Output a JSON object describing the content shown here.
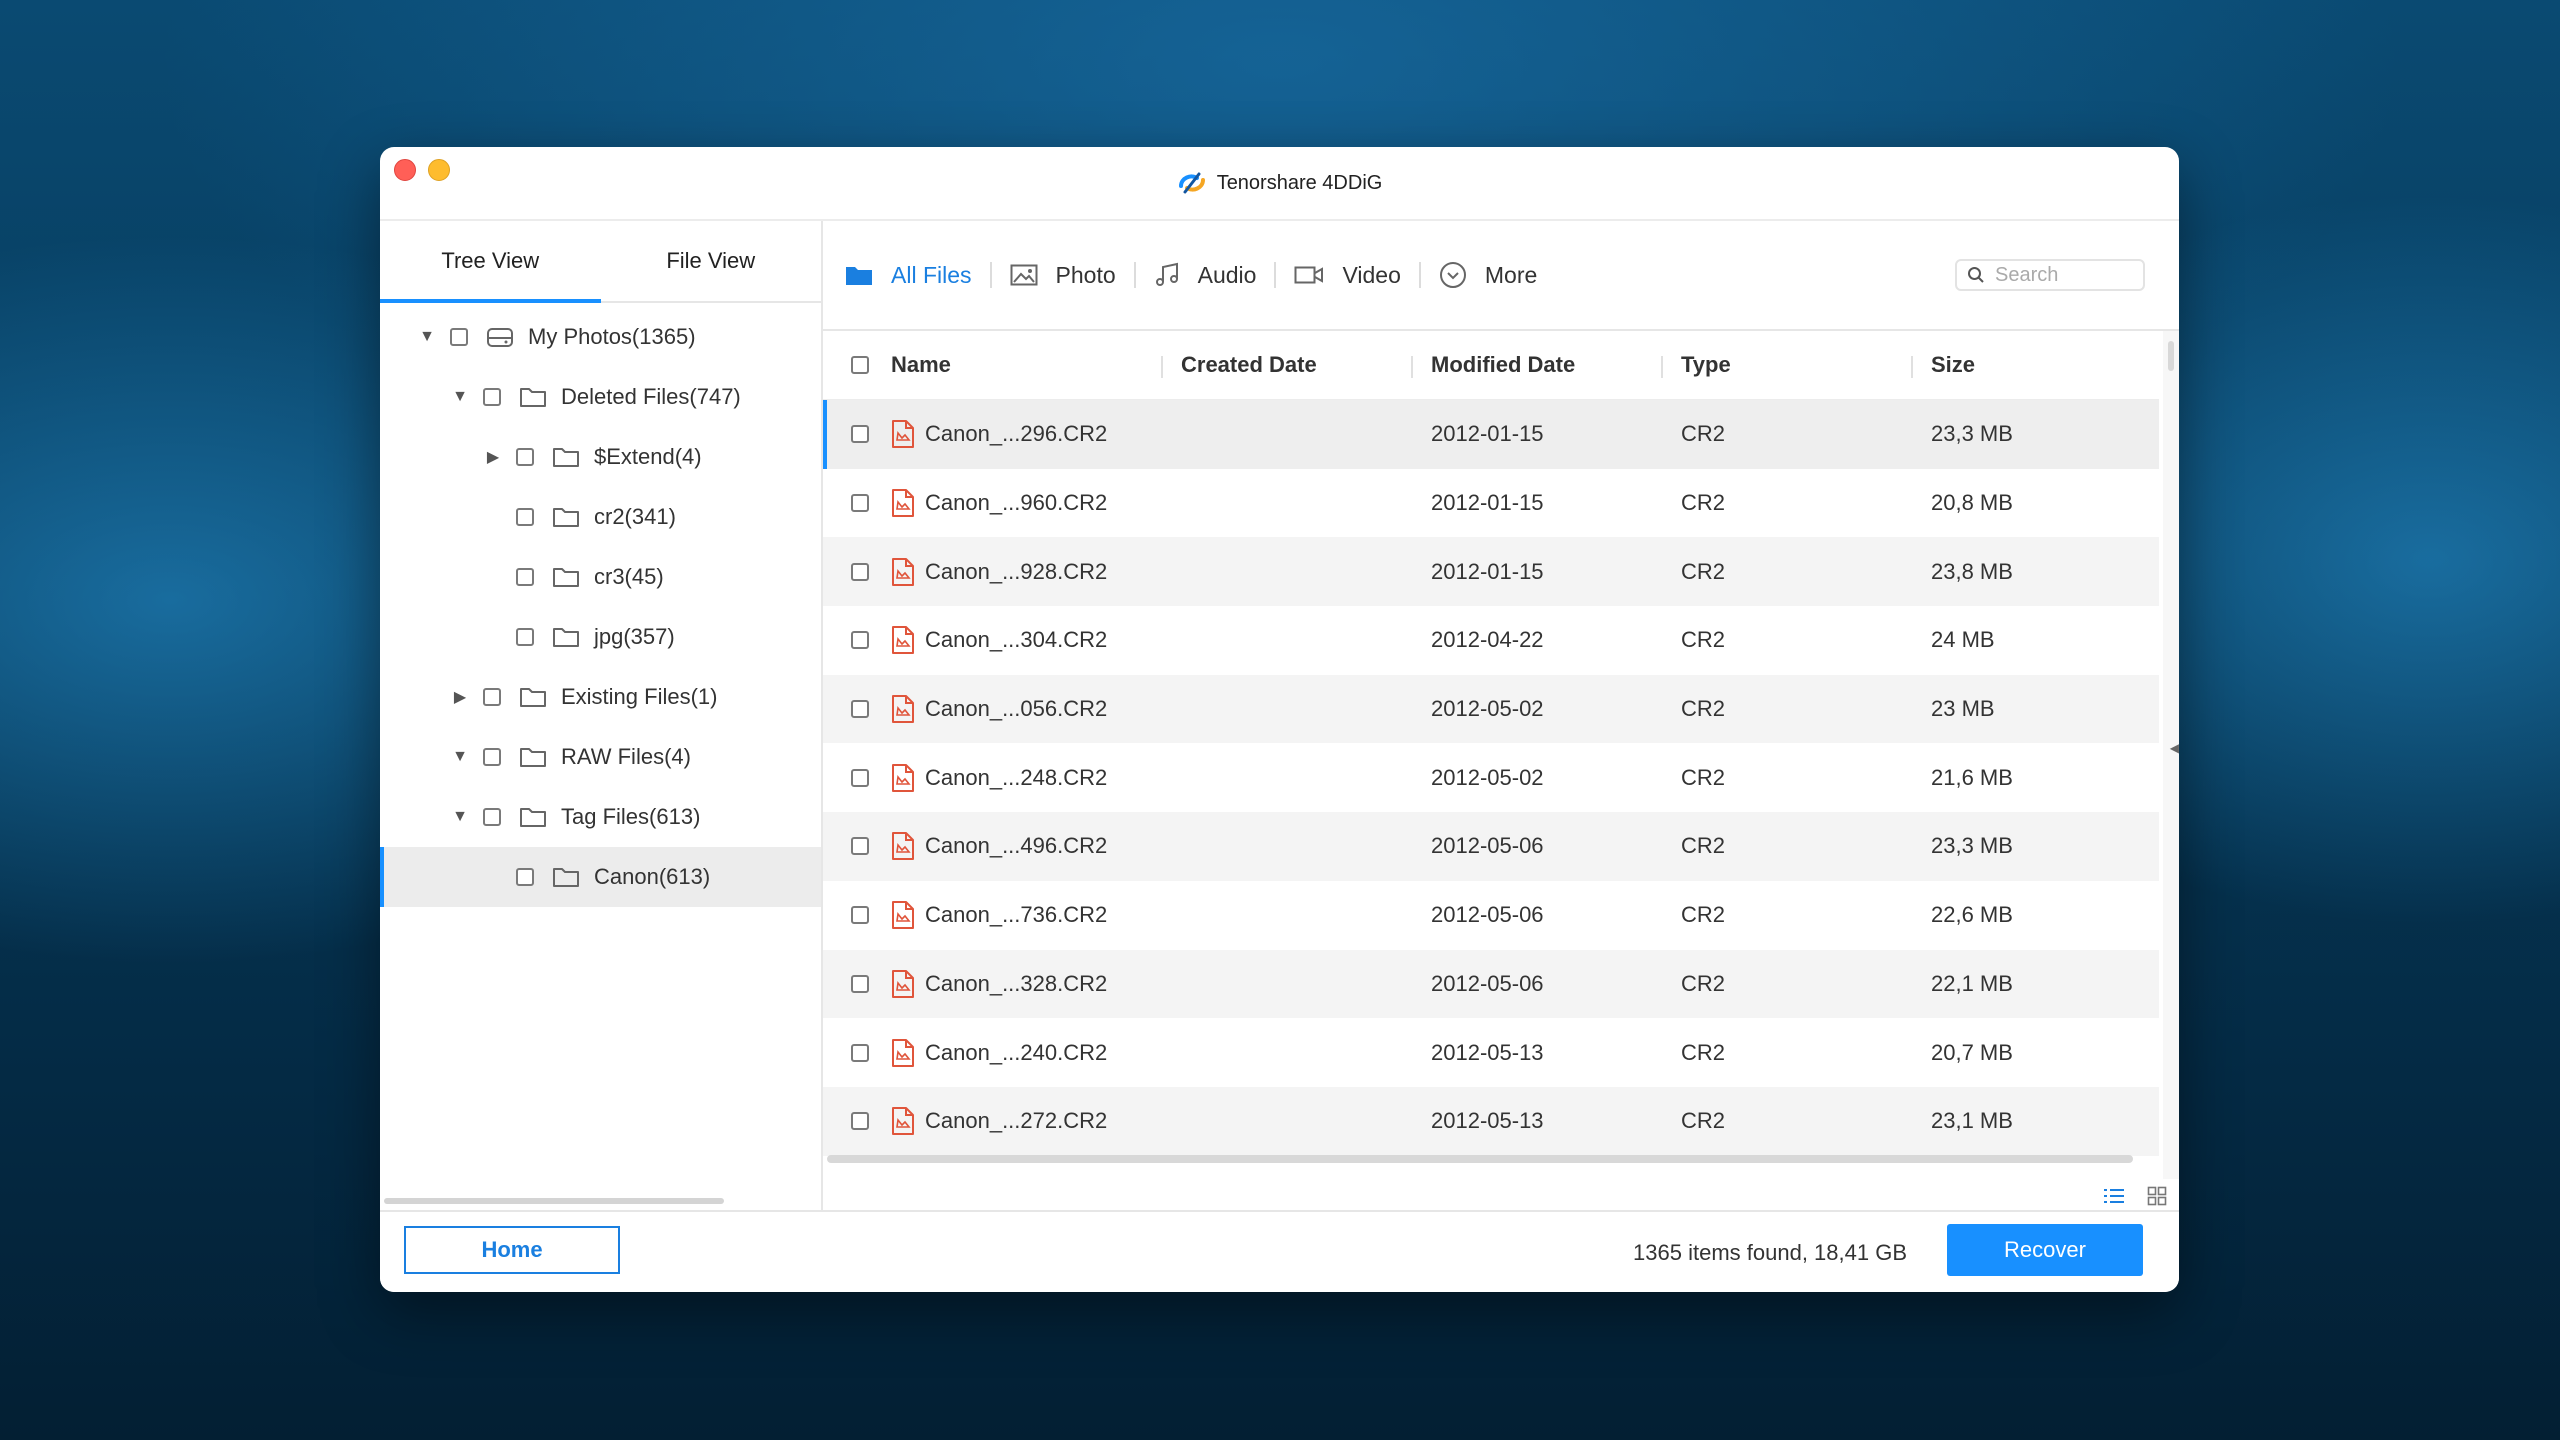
{
  "app": {
    "title": "Tenorshare 4DDiG"
  },
  "view_tabs": {
    "tree": "Tree View",
    "file": "File View"
  },
  "tree": [
    {
      "label": "My Photos(1365)",
      "level": 0,
      "arrow": "down",
      "icon": "drive-icon"
    },
    {
      "label": "Deleted Files(747)",
      "level": 1,
      "arrow": "down",
      "icon": "folder-icon"
    },
    {
      "label": "$Extend(4)",
      "level": 2,
      "arrow": "right",
      "icon": "folder-icon"
    },
    {
      "label": "cr2(341)",
      "level": 2,
      "arrow": "",
      "icon": "folder-icon"
    },
    {
      "label": "cr3(45)",
      "level": 2,
      "arrow": "",
      "icon": "folder-icon"
    },
    {
      "label": "jpg(357)",
      "level": 2,
      "arrow": "",
      "icon": "folder-icon"
    },
    {
      "label": "Existing Files(1)",
      "level": 1,
      "arrow": "right",
      "icon": "folder-icon"
    },
    {
      "label": "RAW Files(4)",
      "level": 1,
      "arrow": "down",
      "icon": "folder-icon"
    },
    {
      "label": "Tag Files(613)",
      "level": 1,
      "arrow": "down",
      "icon": "folder-icon"
    },
    {
      "label": "Canon(613)",
      "level": 2,
      "arrow": "",
      "icon": "folder-icon",
      "selected": true
    }
  ],
  "filters": {
    "all": "All Files",
    "photo": "Photo",
    "audio": "Audio",
    "video": "Video",
    "more": "More"
  },
  "search": {
    "placeholder": "Search"
  },
  "table": {
    "headers": {
      "name": "Name",
      "created": "Created Date",
      "modified": "Modified Date",
      "type": "Type",
      "size": "Size"
    },
    "rows": [
      {
        "name": "Canon_...296.CR2",
        "created": "",
        "modified": "2012-01-15",
        "type": "CR2",
        "size": "23,3 MB"
      },
      {
        "name": "Canon_...960.CR2",
        "created": "",
        "modified": "2012-01-15",
        "type": "CR2",
        "size": "20,8 MB"
      },
      {
        "name": "Canon_...928.CR2",
        "created": "",
        "modified": "2012-01-15",
        "type": "CR2",
        "size": "23,8 MB"
      },
      {
        "name": "Canon_...304.CR2",
        "created": "",
        "modified": "2012-04-22",
        "type": "CR2",
        "size": "24 MB"
      },
      {
        "name": "Canon_...056.CR2",
        "created": "",
        "modified": "2012-05-02",
        "type": "CR2",
        "size": "23 MB"
      },
      {
        "name": "Canon_...248.CR2",
        "created": "",
        "modified": "2012-05-02",
        "type": "CR2",
        "size": "21,6 MB"
      },
      {
        "name": "Canon_...496.CR2",
        "created": "",
        "modified": "2012-05-06",
        "type": "CR2",
        "size": "23,3 MB"
      },
      {
        "name": "Canon_...736.CR2",
        "created": "",
        "modified": "2012-05-06",
        "type": "CR2",
        "size": "22,6 MB"
      },
      {
        "name": "Canon_...328.CR2",
        "created": "",
        "modified": "2012-05-06",
        "type": "CR2",
        "size": "22,1 MB"
      },
      {
        "name": "Canon_...240.CR2",
        "created": "",
        "modified": "2012-05-13",
        "type": "CR2",
        "size": "20,7 MB"
      },
      {
        "name": "Canon_...272.CR2",
        "created": "",
        "modified": "2012-05-13",
        "type": "CR2",
        "size": "23,1 MB"
      }
    ]
  },
  "footer": {
    "home_label": "Home",
    "status": "1365 items found, 18,41 GB",
    "recover_label": "Recover"
  },
  "colors": {
    "accent": "#1890ff",
    "file_icon": "#e0553b"
  }
}
